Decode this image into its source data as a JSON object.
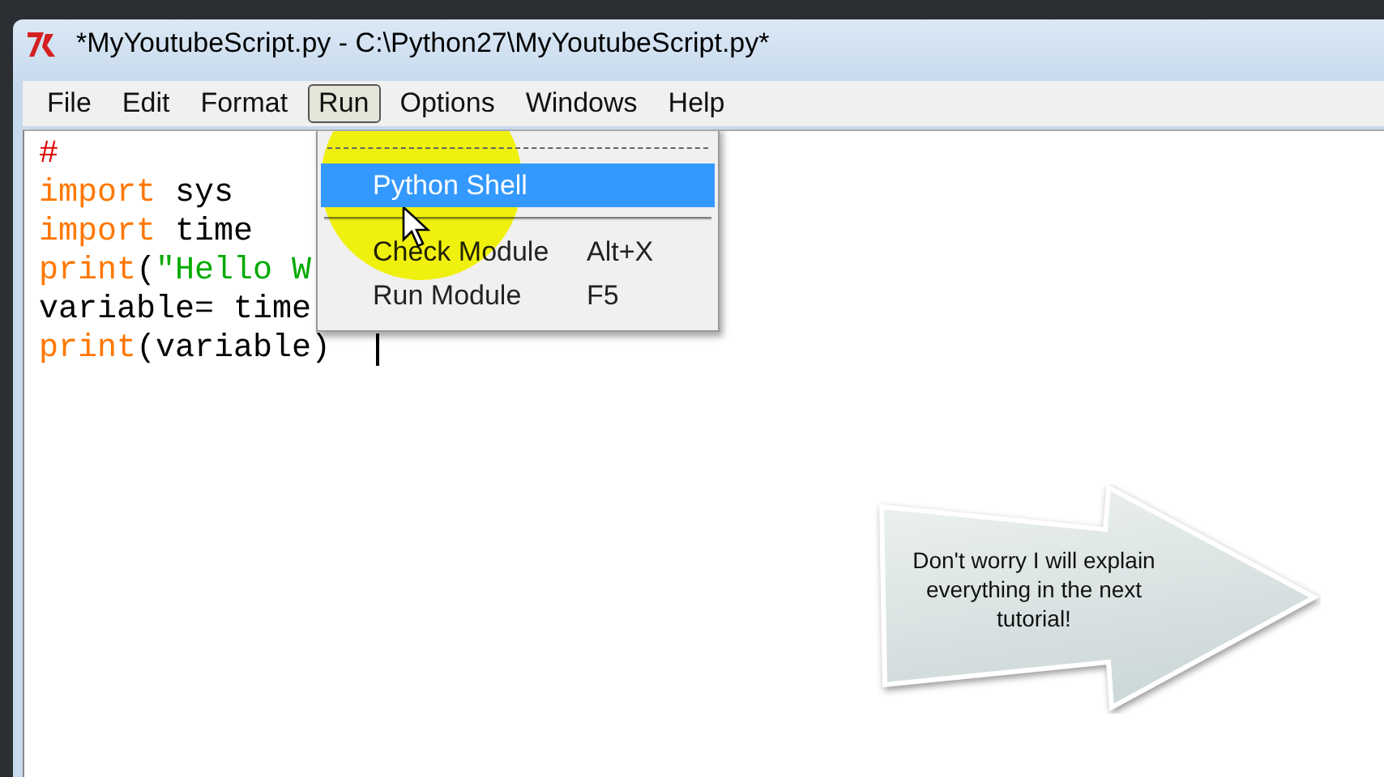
{
  "window": {
    "title": "*MyYoutubeScript.py - C:\\Python27\\MyYoutubeScript.py*"
  },
  "menu_bar": [
    {
      "label": "File",
      "selected": false
    },
    {
      "label": "Edit",
      "selected": false
    },
    {
      "label": "Format",
      "selected": false
    },
    {
      "label": "Run",
      "selected": true
    },
    {
      "label": "Options",
      "selected": false
    },
    {
      "label": "Windows",
      "selected": false
    },
    {
      "label": "Help",
      "selected": false
    }
  ],
  "editor": {
    "lines": [
      [
        {
          "text": "#",
          "kind": "comment"
        }
      ],
      [
        {
          "text": "import",
          "kind": "keyword"
        },
        {
          "text": " sys",
          "kind": "plain"
        }
      ],
      [
        {
          "text": "import",
          "kind": "keyword"
        },
        {
          "text": " time",
          "kind": "plain"
        }
      ],
      [
        {
          "text": "print",
          "kind": "keyword"
        },
        {
          "text": "(",
          "kind": "plain"
        },
        {
          "text": "\"Hello W",
          "kind": "string"
        }
      ],
      [
        {
          "text": "variable= time",
          "kind": "plain"
        }
      ],
      [
        {
          "text": "print",
          "kind": "keyword"
        },
        {
          "text": "(variable)",
          "kind": "plain"
        }
      ]
    ]
  },
  "run_menu": [
    {
      "kind": "tearoff"
    },
    {
      "kind": "command",
      "label": "Python Shell",
      "selected": true
    },
    {
      "kind": "separator"
    },
    {
      "kind": "command",
      "label": "Check Module",
      "shortcut": "Alt+X",
      "selected": false
    },
    {
      "kind": "command",
      "label": "Run Module",
      "shortcut": "F5",
      "selected": false
    }
  ],
  "callout": {
    "text": "Don't worry I will explain everything in the next tutorial!"
  }
}
